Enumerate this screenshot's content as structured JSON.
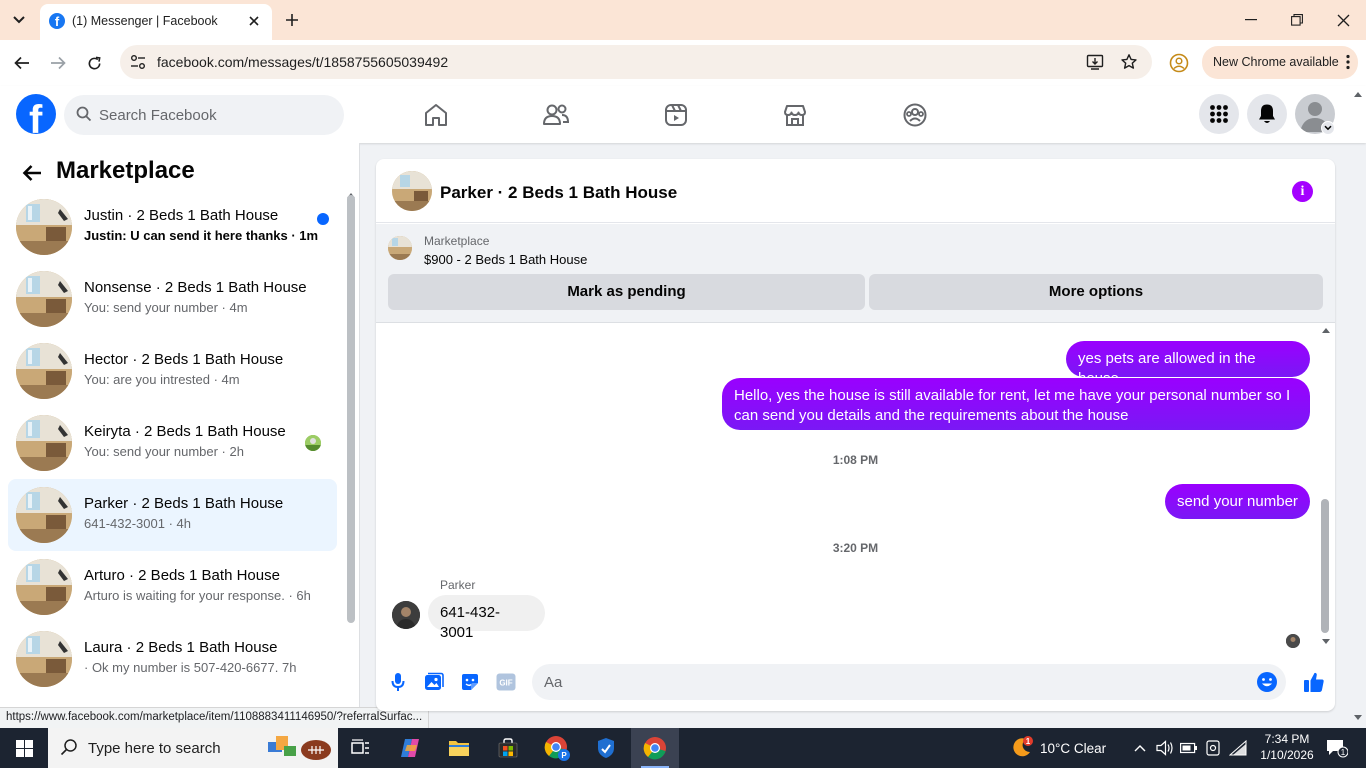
{
  "browser": {
    "tab_title": "(1) Messenger | Facebook",
    "url": "facebook.com/messages/t/1858755605039492",
    "update_label": "New Chrome available",
    "status_url": "https://www.facebook.com/marketplace/item/1108883411146950/?referralSurfac..."
  },
  "fb_header": {
    "search_placeholder": "Search Facebook",
    "nav": [
      "home-icon",
      "friends-icon",
      "video-icon",
      "marketplace-icon",
      "groups-icon"
    ],
    "brand_color": "#0866ff"
  },
  "sidebar": {
    "title": "Marketplace",
    "conversations": [
      {
        "name": "Justin · 2 Beds 1 Bath House",
        "preview": "Justin: U can send it here thanks · 1m",
        "unread": true
      },
      {
        "name": "Nonsense · 2 Beds 1 Bath House",
        "preview": "You: send your number · 4m"
      },
      {
        "name": "Hector · 2 Beds 1 Bath House",
        "preview": "You: are you intrested · 4m"
      },
      {
        "name": "Keiryta · 2 Beds 1 Bath House",
        "preview": "You: send your number · 2h"
      },
      {
        "name": "Parker · 2 Beds 1 Bath House",
        "preview": "641-432-3001 · 4h",
        "active": true
      },
      {
        "name": "Arturo · 2 Beds 1 Bath House",
        "preview": "Arturo is waiting for your response. · 6h"
      },
      {
        "name": "Laura · 2 Beds 1 Bath House",
        "preview": " · Ok my number is 507-420-6677. 7h"
      }
    ]
  },
  "chat": {
    "title": "Parker · 2 Beds 1 Bath House",
    "marketplace_label": "Marketplace",
    "listing": "$900 - 2 Beds 1 Bath House",
    "mark_pending_label": "Mark as pending",
    "more_options_label": "More options",
    "messages": {
      "out1": "yes pets are allowed in the house",
      "out2": "Hello, yes the house is still available for rent, let me have your personal number so I can send you details and the requirements about the house",
      "ts1": "1:08 PM",
      "out3": "send your number",
      "ts2": "3:20 PM",
      "sender": "Parker",
      "in1": "641-432-3001"
    },
    "composer_placeholder": "Aa",
    "accent_color": "#9d00ff"
  },
  "taskbar": {
    "search_label": "Type here to search",
    "weather": "10°C  Clear",
    "time": "7:34 PM",
    "date": "1/10/2026",
    "notification_count": "1"
  }
}
